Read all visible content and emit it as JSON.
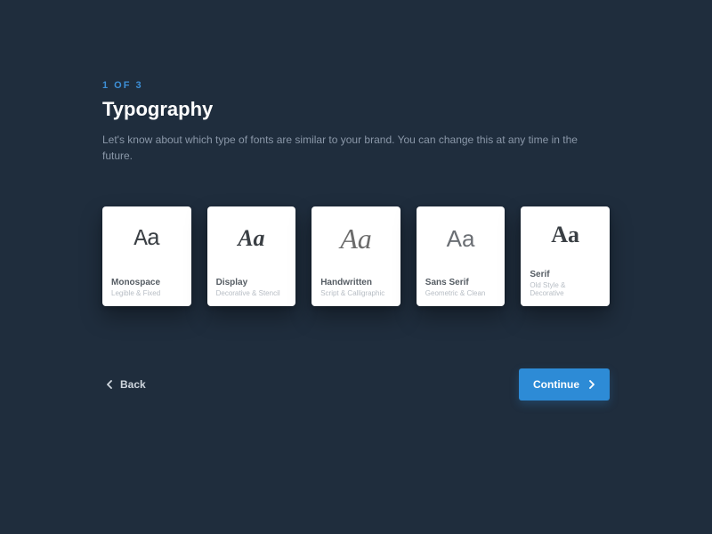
{
  "step": {
    "indicator": "1 OF 3"
  },
  "title": "Typography",
  "description": "Let's know about which type of fonts are similar to your brand. You can change this at any time in the future.",
  "cards": [
    {
      "sample": "Aa",
      "title": "Monospace",
      "subtitle": "Legible & Fixed"
    },
    {
      "sample": "Aa",
      "title": "Display",
      "subtitle": "Decorative & Stencil"
    },
    {
      "sample": "Aa",
      "title": "Handwritten",
      "subtitle": "Script & Calligraphic"
    },
    {
      "sample": "Aa",
      "title": "Sans Serif",
      "subtitle": "Geometric & Clean"
    },
    {
      "sample": "Aa",
      "title": "Serif",
      "subtitle": "Old Style & Decorative"
    }
  ],
  "nav": {
    "back_label": "Back",
    "continue_label": "Continue"
  }
}
